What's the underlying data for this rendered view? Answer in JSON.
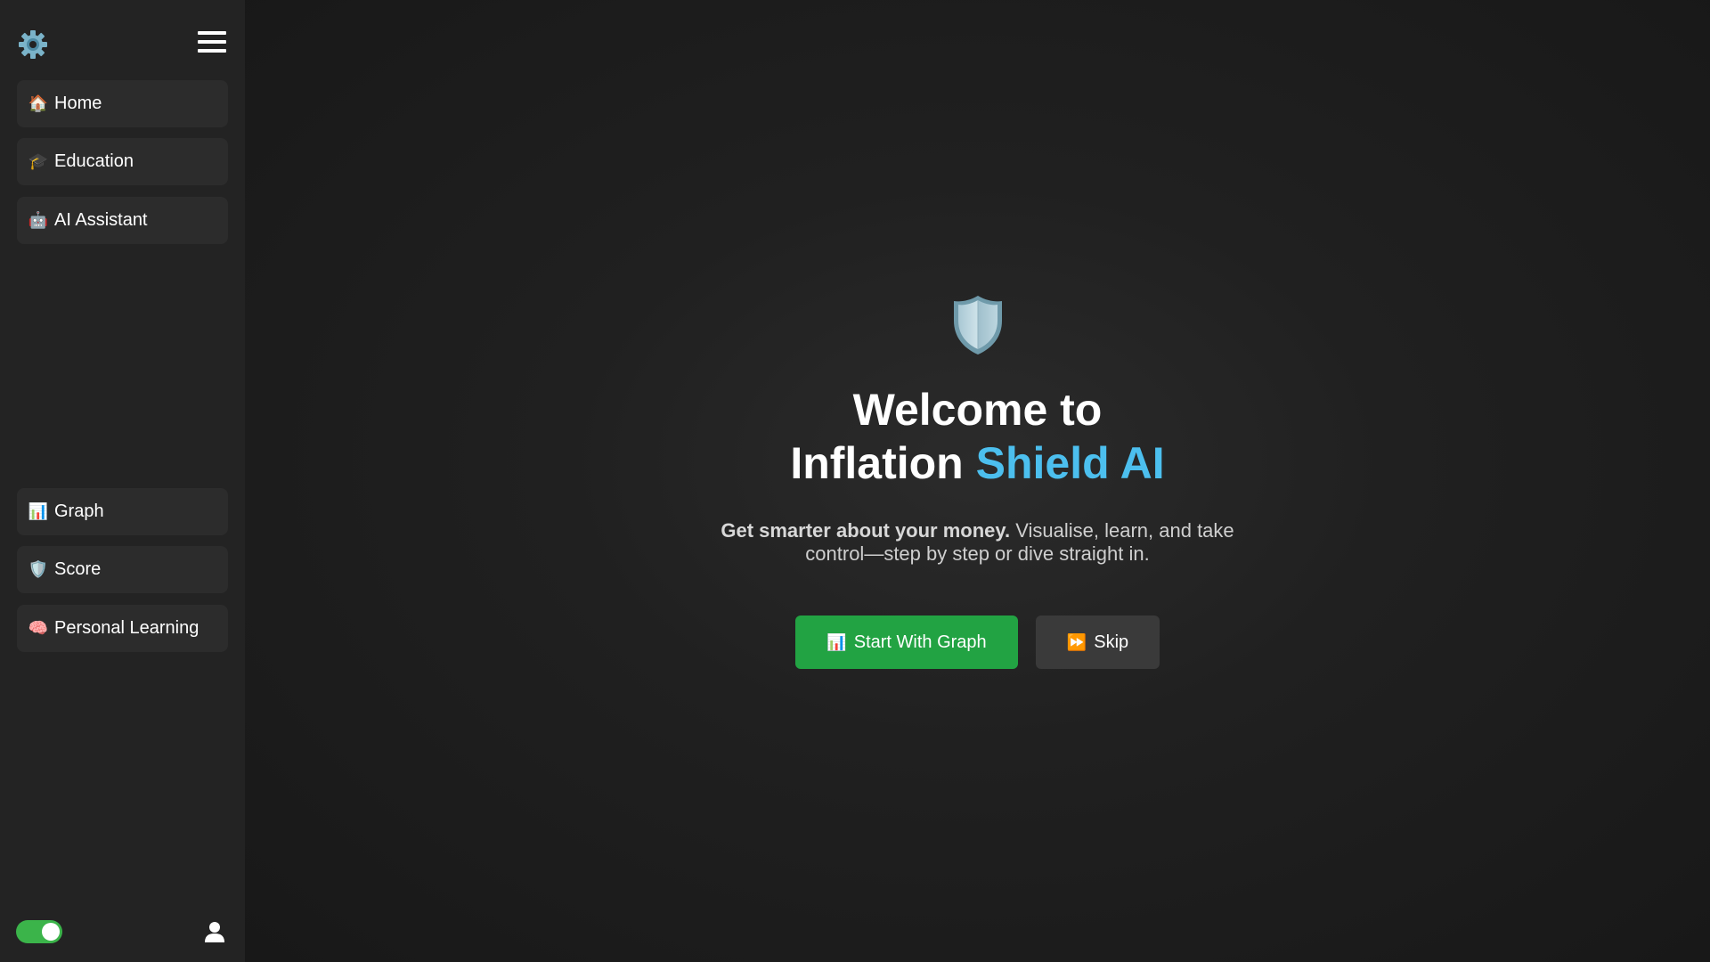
{
  "sidebar": {
    "top_icons": {
      "settings": "gear-icon",
      "menu": "hamburger-icon"
    },
    "nav_top": [
      {
        "emoji": "🏠",
        "label": "Home",
        "icon": "house-icon"
      },
      {
        "emoji": "🎓",
        "label": "Education",
        "icon": "graduation-cap-icon"
      },
      {
        "emoji": "🤖",
        "label": "AI Assistant",
        "icon": "robot-icon"
      }
    ],
    "nav_bottom": [
      {
        "emoji": "📊",
        "label": "Graph",
        "icon": "bar-chart-icon"
      },
      {
        "emoji": "🛡️",
        "label": "Score",
        "icon": "shield-icon"
      },
      {
        "emoji": "🧠",
        "label": "Personal Learning",
        "icon": "brain-icon"
      }
    ],
    "theme_toggle": {
      "on": true,
      "color": "#3bb44a"
    },
    "user_icon": "user-icon"
  },
  "hero": {
    "icon": "shield-icon",
    "title_line1": "Welcome to",
    "title_line2_plain": "Inflation ",
    "title_line2_accent": "Shield AI",
    "subtitle_bold": "Get smarter about your money.",
    "subtitle_rest": " Visualise, learn, and take control—step by step or dive straight in.",
    "primary_button": {
      "emoji": "📊",
      "label": "Start With Graph"
    },
    "secondary_button": {
      "emoji": "⏩",
      "label": "Skip"
    }
  },
  "colors": {
    "accent": "#4cbfee",
    "primary_button": "#22a343",
    "secondary_button": "#3a3a3a",
    "sidebar_bg": "#232323",
    "nav_item_bg": "#2c2c2c"
  }
}
